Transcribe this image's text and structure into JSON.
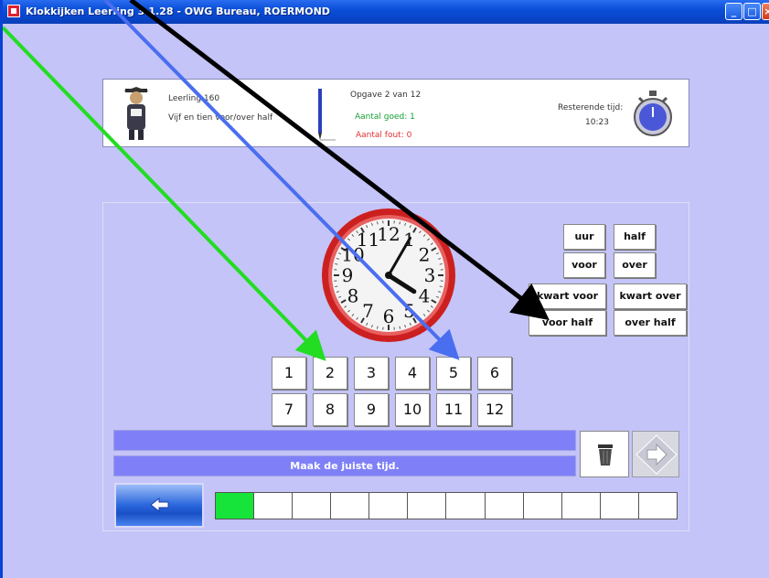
{
  "window": {
    "title": "Klokkijken Leerling 3.1.28 - OWG Bureau, ROERMOND",
    "minimize_icon": "_",
    "maximize_icon": "□",
    "close_icon": "×"
  },
  "info": {
    "student": "Leerling 160",
    "subject": "Vijf en tien voor/over half",
    "assignment": "Opgave 2 van 12",
    "good": "Aantal goed: 1",
    "bad": "Aantal fout: 0",
    "remaining_label": "Resterende tijd:",
    "remaining_time": "10:23"
  },
  "clock": {
    "numerals": [
      "12",
      "1",
      "2",
      "3",
      "4",
      "5",
      "6",
      "7",
      "8",
      "9",
      "10",
      "11"
    ],
    "hour": 4,
    "minute": 5
  },
  "word_buttons": [
    "uur",
    "half",
    "voor",
    "over",
    "kwart voor",
    "kwart over",
    "voor half",
    "over half"
  ],
  "number_buttons": [
    "1",
    "2",
    "3",
    "4",
    "5",
    "6",
    "7",
    "8",
    "9",
    "10",
    "11",
    "12"
  ],
  "answer_bar": "",
  "instruction": "Maak de juiste tijd.",
  "progress": {
    "total": 12,
    "completed": 1
  },
  "colors": {
    "background": "#c4c4f8",
    "bar": "#7f80f8",
    "progress_done": "#17e43a",
    "good_text": "#16a034",
    "bad_text": "#e03030",
    "arrow_green": "#22dd22",
    "arrow_blue": "#4a6ef0",
    "arrow_black": "#000000"
  },
  "icons": {
    "trash": "trash-icon",
    "next": "arrow-right-icon",
    "back": "arrow-left-icon"
  }
}
